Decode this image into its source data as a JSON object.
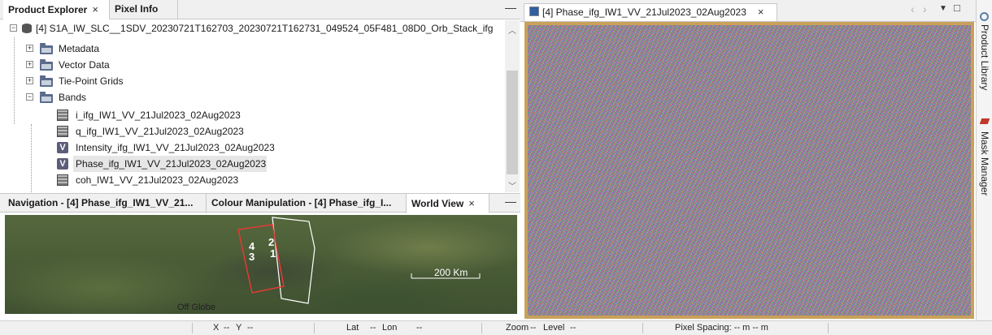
{
  "left_panel": {
    "tabs": [
      {
        "label": "Product Explorer",
        "close": "×"
      },
      {
        "label": "Pixel Info"
      }
    ],
    "minimize": "—",
    "tree": {
      "product": "[4] S1A_IW_SLC__1SDV_20230721T162703_20230721T162731_049524_05F481_08D0_Orb_Stack_ifg",
      "folders": [
        "Metadata",
        "Vector Data",
        "Tie-Point Grids",
        "Bands"
      ],
      "bands": [
        {
          "label": "i_ifg_IW1_VV_21Jul2023_02Aug2023",
          "icon": "band-icon"
        },
        {
          "label": "q_ifg_IW1_VV_21Jul2023_02Aug2023",
          "icon": "band-icon"
        },
        {
          "label": "Intensity_ifg_IW1_VV_21Jul2023_02Aug2023",
          "icon": "virtual-band-icon",
          "glyph": "V"
        },
        {
          "label": "Phase_ifg_IW1_VV_21Jul2023_02Aug2023",
          "icon": "virtual-band-icon",
          "glyph": "V",
          "selected": true
        },
        {
          "label": "coh_IW1_VV_21Jul2023_02Aug2023",
          "icon": "band-icon"
        }
      ]
    }
  },
  "bottom_panel": {
    "tabs": [
      {
        "label": "Navigation - [4] Phase_ifg_IW1_VV_21..."
      },
      {
        "label": "Colour Manipulation - [4] Phase_ifg_I..."
      },
      {
        "label": "World View",
        "close": "×"
      }
    ],
    "minimize": "—",
    "world_view": {
      "footprint_labels": [
        "4",
        "2",
        "3",
        "1"
      ],
      "scale_label": "200 Km",
      "footer": "Off Globe"
    }
  },
  "image_window": {
    "tab_label": "[4] Phase_ifg_IW1_VV_21Jul2023_02Aug2023",
    "close": "×",
    "nav_left": "‹",
    "nav_right": "›",
    "dropdown": "▼",
    "restore": "□"
  },
  "right_sidebar": {
    "items": [
      "Product Library",
      "Mask Manager"
    ]
  },
  "status_bar": {
    "x_label": "X",
    "x_value": "--",
    "y_label": "Y",
    "y_value": "--",
    "lat_label": "Lat",
    "lat_value": "--",
    "lon_label": "Lon",
    "lon_value": "--",
    "zoom_label": "Zoom",
    "zoom_value": "--",
    "level_label": "Level",
    "level_value": "--",
    "pixel_spacing": "Pixel Spacing: -- m -- m"
  },
  "colors": {
    "footprint_selected": "#e53935",
    "footprint_other": "#ffffff",
    "viewer_border": "#c9a15a"
  }
}
